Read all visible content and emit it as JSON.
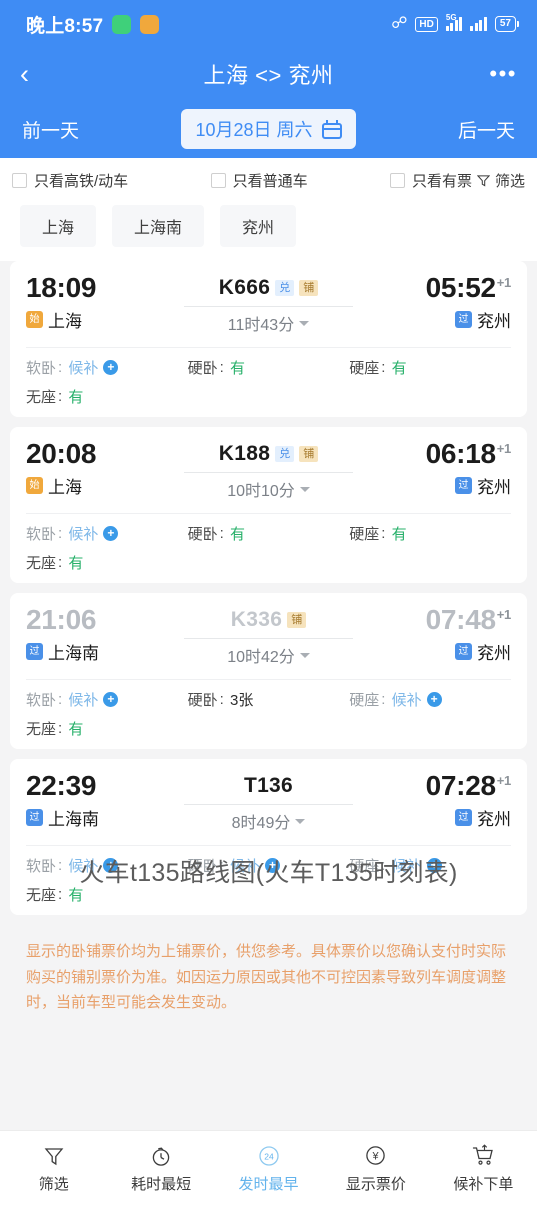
{
  "status_bar": {
    "time": "晚上8:57",
    "app_icons": [
      "wechat-green-icon",
      "memo-orange-icon"
    ],
    "icons": [
      "bluetooth-icon",
      "hd-icon",
      "5g-signal-icon",
      "signal-icon"
    ],
    "hd_label": "HD",
    "network_label": "5G",
    "battery_level": "57"
  },
  "nav": {
    "back_label": "‹",
    "title": "上海 <> 兖州",
    "more_label": "•••"
  },
  "date_bar": {
    "prev_label": "前一天",
    "date_label": "10月28日 周六",
    "next_label": "后一天"
  },
  "filters": {
    "checkboxes": [
      {
        "label": "只看高铁/动车",
        "checked": false
      },
      {
        "label": "只看普通车",
        "checked": false
      },
      {
        "label": "只看有票",
        "checked": false
      }
    ],
    "filter_button": "筛选"
  },
  "station_tabs": [
    "上海",
    "上海南",
    "兖州"
  ],
  "trains": [
    {
      "dep_time": "18:09",
      "dep_station": "上海",
      "dep_badge": "始",
      "dep_badge_type": "start",
      "train_no": "K666",
      "badges": [
        "兑",
        "铺"
      ],
      "duration": "11时43分",
      "arr_time": "05:52",
      "arr_day_offset": "+1",
      "arr_station": "兖州",
      "arr_badge": "过",
      "arr_badge_type": "pass",
      "dimmed": false,
      "seats": [
        {
          "label": "软卧",
          "value": "候补",
          "type": "wait",
          "label_gray": true
        },
        {
          "label": "硬卧",
          "value": "有",
          "type": "ok",
          "label_gray": false
        },
        {
          "label": "硬座",
          "value": "有",
          "type": "ok",
          "label_gray": false
        },
        {
          "label": "无座",
          "value": "有",
          "type": "ok",
          "label_gray": false
        }
      ]
    },
    {
      "dep_time": "20:08",
      "dep_station": "上海",
      "dep_badge": "始",
      "dep_badge_type": "start",
      "train_no": "K188",
      "badges": [
        "兑",
        "铺"
      ],
      "duration": "10时10分",
      "arr_time": "06:18",
      "arr_day_offset": "+1",
      "arr_station": "兖州",
      "arr_badge": "过",
      "arr_badge_type": "pass",
      "dimmed": false,
      "seats": [
        {
          "label": "软卧",
          "value": "候补",
          "type": "wait",
          "label_gray": true
        },
        {
          "label": "硬卧",
          "value": "有",
          "type": "ok",
          "label_gray": false
        },
        {
          "label": "硬座",
          "value": "有",
          "type": "ok",
          "label_gray": false
        },
        {
          "label": "无座",
          "value": "有",
          "type": "ok",
          "label_gray": false
        }
      ]
    },
    {
      "dep_time": "21:06",
      "dep_station": "上海南",
      "dep_badge": "过",
      "dep_badge_type": "pass",
      "train_no": "K336",
      "badges": [
        "铺"
      ],
      "duration": "10时42分",
      "arr_time": "07:48",
      "arr_day_offset": "+1",
      "arr_station": "兖州",
      "arr_badge": "过",
      "arr_badge_type": "pass",
      "dimmed": true,
      "seats": [
        {
          "label": "软卧",
          "value": "候补",
          "type": "wait",
          "label_gray": true
        },
        {
          "label": "硬卧",
          "value": "3张",
          "type": "num",
          "label_gray": false
        },
        {
          "label": "硬座",
          "value": "候补",
          "type": "wait",
          "label_gray": true
        },
        {
          "label": "无座",
          "value": "有",
          "type": "ok",
          "label_gray": false
        }
      ]
    },
    {
      "dep_time": "22:39",
      "dep_station": "上海南",
      "dep_badge": "过",
      "dep_badge_type": "pass",
      "train_no": "T136",
      "badges": [],
      "duration": "8时49分",
      "arr_time": "07:28",
      "arr_day_offset": "+1",
      "arr_station": "兖州",
      "arr_badge": "过",
      "arr_badge_type": "pass",
      "dimmed": false,
      "seats": [
        {
          "label": "软卧",
          "value": "候补",
          "type": "wait",
          "label_gray": true
        },
        {
          "label": "硬卧",
          "value": "候补",
          "type": "wait",
          "label_gray": true
        },
        {
          "label": "硬座",
          "value": "候补",
          "type": "wait",
          "label_gray": true
        },
        {
          "label": "无座",
          "value": "有",
          "type": "ok",
          "label_gray": false
        }
      ]
    }
  ],
  "notice": "显示的卧铺票价均为上铺票价，供您参考。具体票价以您确认支付时实际购买的铺别票价为准。如因运力原因或其他不可控因素导致列车调度调整时，当前车型可能会发生变动。",
  "watermark": "火车t135路线图(火车T135时刻表)",
  "bottom_bar": [
    {
      "label": "筛选",
      "icon": "funnel-icon",
      "active": false
    },
    {
      "label": "耗时最短",
      "icon": "stopwatch-icon",
      "active": false
    },
    {
      "label": "发时最早",
      "icon": "clock-24-icon",
      "active": true
    },
    {
      "label": "显示票价",
      "icon": "yen-circle-icon",
      "active": false
    },
    {
      "label": "候补下单",
      "icon": "cart-icon",
      "active": false
    }
  ],
  "colors": {
    "brand_blue": "#3f8cf4",
    "available_green": "#27b06a",
    "waitlist_blue": "#7fb8e8",
    "notice_orange": "#e8a06a",
    "start_badge": "#f0a83c",
    "pass_badge": "#4a90e8"
  }
}
